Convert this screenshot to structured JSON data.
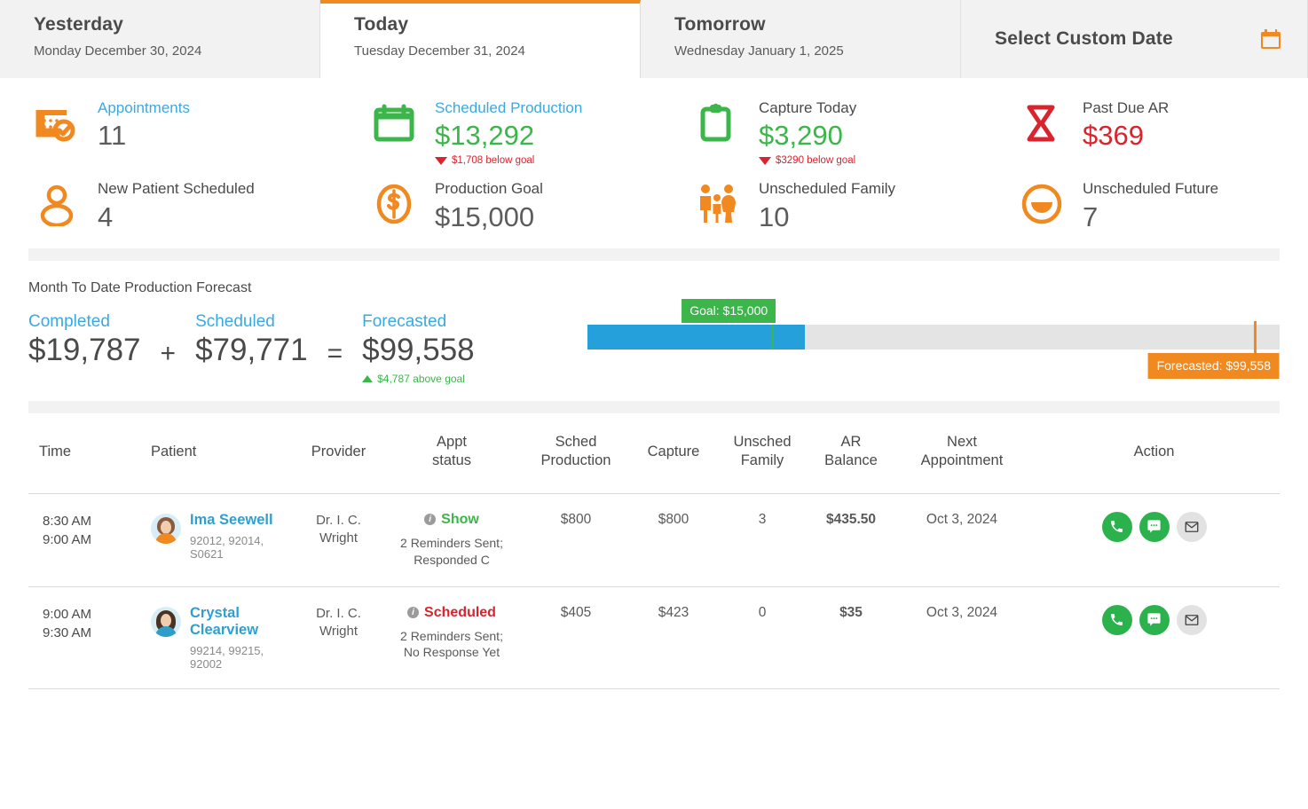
{
  "tabs": [
    {
      "title": "Yesterday",
      "date": "Monday December 30, 2024",
      "active": false
    },
    {
      "title": "Today",
      "date": "Tuesday December 31, 2024",
      "active": true
    },
    {
      "title": "Tomorrow",
      "date": "Wednesday January 1, 2025",
      "active": false
    }
  ],
  "custom_date": {
    "label": "Select Custom Date",
    "icon": "calendar-icon"
  },
  "kpis": {
    "appointments": {
      "label": "Appointments",
      "value": "11",
      "icon": "calendar-check-icon"
    },
    "scheduled_production": {
      "label": "Scheduled Production",
      "value": "$13,292",
      "icon": "calendar-icon",
      "delta": "$1,708 below goal",
      "delta_dir": "down"
    },
    "capture_today": {
      "label": "Capture Today",
      "value": "$3,290",
      "icon": "clipboard-icon",
      "delta": "$3290 below goal",
      "delta_dir": "down"
    },
    "past_due_ar": {
      "label": "Past Due AR",
      "value": "$369",
      "icon": "hourglass-icon"
    },
    "new_patient": {
      "label": "New Patient Scheduled",
      "value": "4",
      "icon": "person-icon"
    },
    "production_goal": {
      "label": "Production Goal",
      "value": "$15,000",
      "icon": "dollar-circle-icon"
    },
    "unscheduled_family": {
      "label": "Unscheduled Family",
      "value": "10",
      "icon": "family-icon"
    },
    "unscheduled_future": {
      "label": "Unscheduled Future",
      "value": "7",
      "icon": "smiley-icon"
    }
  },
  "forecast": {
    "title": "Month To Date Production Forecast",
    "completed_label": "Completed",
    "completed_value": "$19,787",
    "plus": "+",
    "scheduled_label": "Scheduled",
    "scheduled_value": "$79,771",
    "equals": "=",
    "forecasted_label": "Forecasted",
    "forecasted_value": "$99,558",
    "delta": "$4,787 above goal",
    "goal_tag": "Goal: $15,000",
    "forecast_tag": "Forecasted: $99,558"
  },
  "chart_data": {
    "type": "bar",
    "title": "Month To Date Production Forecast",
    "categories": [
      "Completed"
    ],
    "values": [
      19787
    ],
    "goal": 15000,
    "forecast": 99558,
    "scheduled": 79771,
    "axis_max": 103000,
    "bar_fill_pct": 31.4,
    "goal_marker_pct": 26.8,
    "forecast_marker_pct": 96.5,
    "colors": {
      "fill": "#26a0db",
      "track": "#e4e4e4",
      "goal": "#3cb54a",
      "forecast": "#f0891f"
    }
  },
  "table": {
    "headers": [
      "Time",
      "Patient",
      "Provider",
      "Appt status",
      "Sched Production",
      "Capture",
      "Unsched Family",
      "AR Balance",
      "Next Appointment",
      "Action"
    ],
    "header_lines": {
      "appt": [
        "Appt",
        "status"
      ],
      "sched": [
        "Sched",
        "Production"
      ],
      "unsched": [
        "Unsched",
        "Family"
      ],
      "ar": [
        "AR",
        "Balance"
      ],
      "next": [
        "Next",
        "Appointment"
      ]
    },
    "rows": [
      {
        "time_start": "8:30 AM",
        "time_end": "9:00 AM",
        "patient": "Ima Seewell",
        "codes": "92012, 92014, S0621",
        "provider_line1": "Dr. I. C.",
        "provider_line2": "Wright",
        "status": "Show",
        "status_type": "show",
        "status_note1": "2 Reminders Sent;",
        "status_note2": "Responded C",
        "sched_production": "$800",
        "capture": "$800",
        "unsched_family": "3",
        "ar_balance": "$435.50",
        "next_appointment": "Oct 3, 2024",
        "actions": [
          "phone-icon",
          "message-icon",
          "email-icon"
        ]
      },
      {
        "time_start": "9:00 AM",
        "time_end": "9:30 AM",
        "patient": "Crystal Clearview",
        "codes": "99214, 99215, 92002",
        "provider_line1": "Dr. I. C.",
        "provider_line2": "Wright",
        "status": "Scheduled",
        "status_type": "scheduled",
        "status_note1": "2 Reminders Sent;",
        "status_note2": "No Response Yet",
        "sched_production": "$405",
        "capture": "$423",
        "unsched_family": "0",
        "ar_balance": "$35",
        "next_appointment": "Oct 3, 2024",
        "actions": [
          "phone-icon",
          "message-icon",
          "email-icon"
        ]
      }
    ]
  },
  "colors": {
    "accent_orange": "#f0891f",
    "blue": "#3aa9e0",
    "green": "#3cb54a",
    "red": "#d9232d",
    "bar_blue": "#26a0db"
  }
}
